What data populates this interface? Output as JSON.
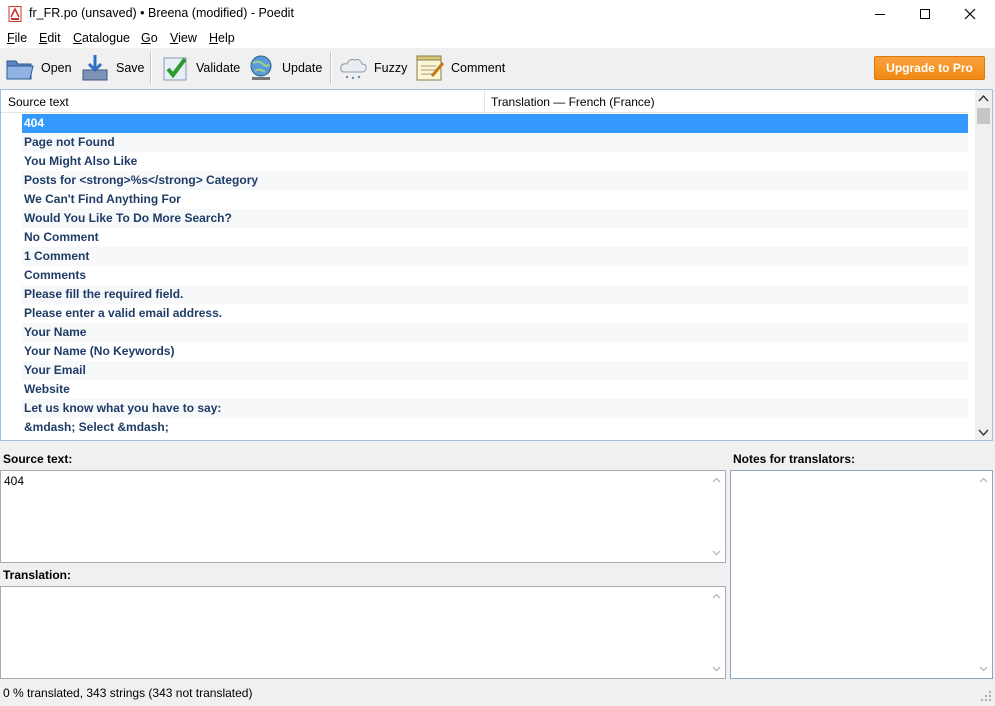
{
  "window": {
    "title": "fr_FR.po (unsaved) • Breena (modified) - Poedit"
  },
  "menu": [
    {
      "label": "File",
      "u": "F",
      "rest": "ile"
    },
    {
      "label": "Edit",
      "u": "E",
      "rest": "dit"
    },
    {
      "label": "Catalogue",
      "u": "C",
      "rest": "atalogue"
    },
    {
      "label": "Go",
      "u": "G",
      "rest": "o"
    },
    {
      "label": "View",
      "u": "V",
      "rest": "iew"
    },
    {
      "label": "Help",
      "u": "H",
      "rest": "elp"
    }
  ],
  "toolbar": {
    "open": "Open",
    "save": "Save",
    "validate": "Validate",
    "update": "Update",
    "fuzzy": "Fuzzy",
    "comment": "Comment",
    "upgrade": "Upgrade to Pro"
  },
  "list": {
    "col_source": "Source text",
    "col_translation": "Translation — French (France)",
    "selected_index": 0,
    "rows": [
      "404",
      "Page not Found",
      "You Might Also Like",
      "Posts for <strong>%s</strong> Category",
      "We Can't Find Anything For",
      "Would You Like To Do More Search?",
      "No Comment",
      "1 Comment",
      "Comments",
      "Please fill the required field.",
      "Please enter a valid email address.",
      "Your Name",
      "Your Name (No Keywords)",
      "Your Email",
      "Website",
      "Let us know what you have to say:",
      "&mdash; Select &mdash;"
    ]
  },
  "editor": {
    "source_label": "Source text:",
    "source_value": "404",
    "translation_label": "Translation:",
    "translation_value": "",
    "notes_label": "Notes for translators:"
  },
  "status": "0 % translated, 343 strings (343 not translated)"
}
